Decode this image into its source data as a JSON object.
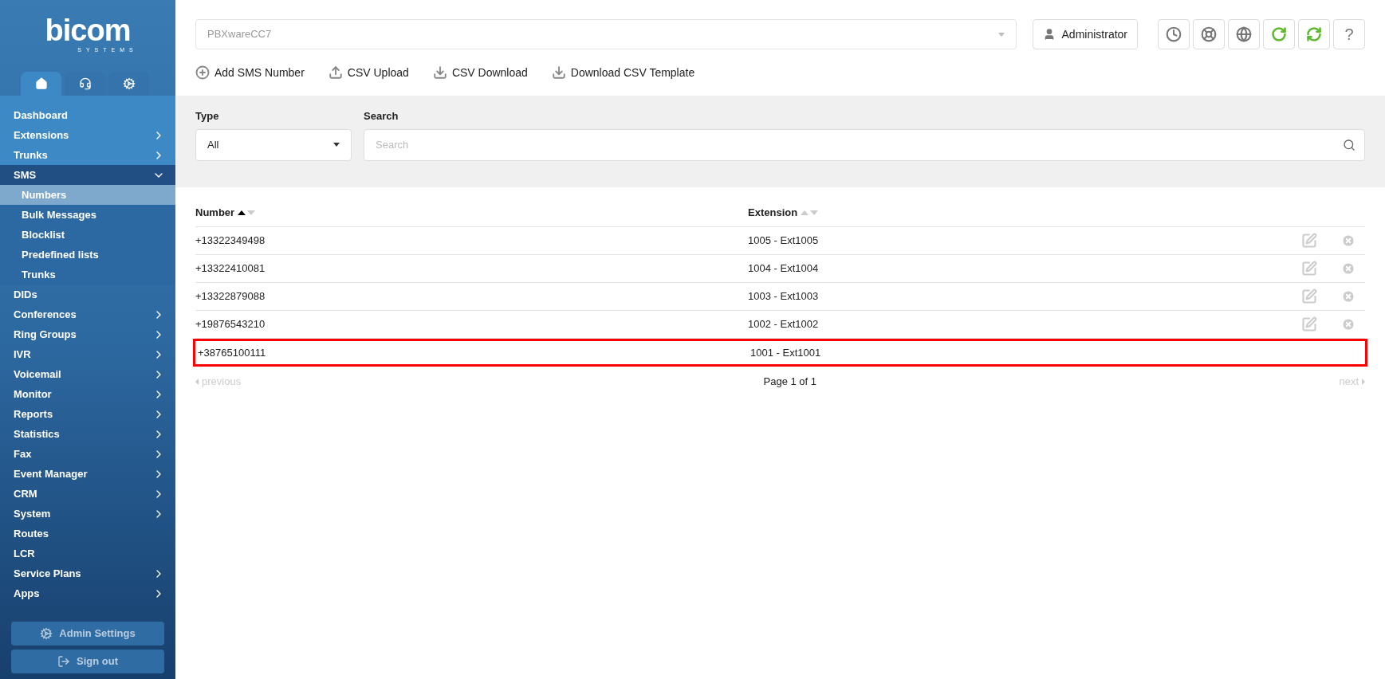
{
  "logo": {
    "name": "bicom",
    "tagline": "SYSTEMS"
  },
  "sidebar_tabs": [
    {
      "kind": "home",
      "selected": true
    },
    {
      "kind": "headset",
      "selected": false
    },
    {
      "kind": "gears",
      "selected": false
    }
  ],
  "sidebar": {
    "items": [
      {
        "label": "Dashboard",
        "expandable": false
      },
      {
        "label": "Extensions",
        "expandable": true,
        "expanded": false
      },
      {
        "label": "Trunks",
        "expandable": true,
        "expanded": false
      },
      {
        "label": "SMS",
        "expandable": true,
        "expanded": true,
        "children": [
          {
            "label": "Numbers",
            "selected": true
          },
          {
            "label": "Bulk Messages",
            "selected": false
          },
          {
            "label": "Blocklist",
            "selected": false
          },
          {
            "label": "Predefined lists",
            "selected": false
          },
          {
            "label": "Trunks",
            "selected": false
          }
        ]
      },
      {
        "label": "DIDs",
        "expandable": false
      },
      {
        "label": "Conferences",
        "expandable": true,
        "expanded": false
      },
      {
        "label": "Ring Groups",
        "expandable": true,
        "expanded": false
      },
      {
        "label": "IVR",
        "expandable": true,
        "expanded": false
      },
      {
        "label": "Voicemail",
        "expandable": true,
        "expanded": false
      },
      {
        "label": "Monitor",
        "expandable": true,
        "expanded": false
      },
      {
        "label": "Reports",
        "expandable": true,
        "expanded": false
      },
      {
        "label": "Statistics",
        "expandable": true,
        "expanded": false
      },
      {
        "label": "Fax",
        "expandable": true,
        "expanded": false
      },
      {
        "label": "Event Manager",
        "expandable": true,
        "expanded": false
      },
      {
        "label": "CRM",
        "expandable": true,
        "expanded": false
      },
      {
        "label": "System",
        "expandable": true,
        "expanded": false
      },
      {
        "label": "Routes",
        "expandable": false
      },
      {
        "label": "LCR",
        "expandable": false
      },
      {
        "label": "Service Plans",
        "expandable": true,
        "expanded": false
      },
      {
        "label": "Apps",
        "expandable": true,
        "expanded": false
      }
    ],
    "buttons": [
      {
        "kind": "settings",
        "label": "Admin Settings"
      },
      {
        "kind": "signout",
        "label": "Sign out"
      }
    ]
  },
  "header": {
    "server_select": "PBXwareCC7",
    "user_button": "Administrator",
    "icon_buttons": [
      {
        "kind": "clock"
      },
      {
        "kind": "support"
      },
      {
        "kind": "globe"
      },
      {
        "kind": "reload"
      },
      {
        "kind": "sync"
      },
      {
        "kind": "help",
        "label": "?"
      }
    ]
  },
  "toolbar": [
    {
      "kind": "add",
      "label": "Add SMS Number"
    },
    {
      "kind": "upload",
      "label": "CSV Upload"
    },
    {
      "kind": "download",
      "label": "CSV Download"
    },
    {
      "kind": "download",
      "label": "Download CSV Template"
    }
  ],
  "filters": {
    "type": {
      "label": "Type",
      "value": "All"
    },
    "search": {
      "label": "Search",
      "placeholder": "Search"
    }
  },
  "table": {
    "columns": [
      {
        "label": "Number",
        "sorted_ascending": true
      },
      {
        "label": "Extension",
        "sorted_ascending": false
      }
    ],
    "rows": [
      {
        "number": "+13322349498",
        "extension": "1005 - Ext1005",
        "actions": true,
        "highlighted": false
      },
      {
        "number": "+13322410081",
        "extension": "1004 - Ext1004",
        "actions": true,
        "highlighted": false
      },
      {
        "number": "+13322879088",
        "extension": "1003 - Ext1003",
        "actions": true,
        "highlighted": false
      },
      {
        "number": "+19876543210",
        "extension": "1002 - Ext1002",
        "actions": true,
        "highlighted": false
      },
      {
        "number": "+38765100111",
        "extension": "1001 - Ext1001",
        "actions": false,
        "highlighted": true
      }
    ]
  },
  "pagination": {
    "previous": "previous",
    "page": "Page 1 of 1",
    "next": "next",
    "previous_disabled": true,
    "next_disabled": true
  }
}
